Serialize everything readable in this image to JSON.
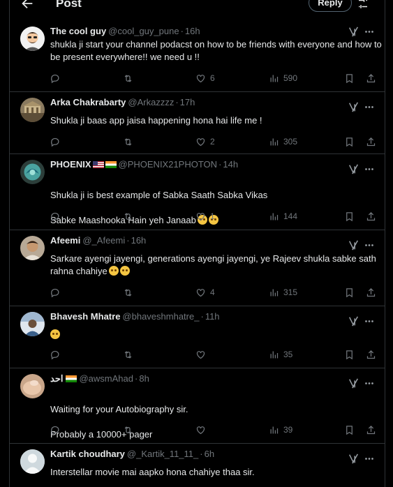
{
  "header": {
    "title": "Post",
    "reply_button": "Reply"
  },
  "tweets": [
    {
      "name": "The cool guy",
      "handle": "@cool_guy_pune",
      "time": "16h",
      "text": "shukla ji start your channel podacst on how to be friends with everyone and how to be present everywhere!! we need u !!",
      "replies": "",
      "retweets": "",
      "likes": "6",
      "views": "590"
    },
    {
      "name": "Arka Chakrabarty",
      "handle": "@Arkazzzz",
      "time": "17h",
      "text": "Shukla ji baas app jaisa happening hona hai life me !",
      "replies": "",
      "retweets": "",
      "likes": "2",
      "views": "305"
    },
    {
      "name": "PHOENIX",
      "handle": "@PHOENIX21PHOTON",
      "time": "14h",
      "text_line1": "Shukla ji is best example of Sabka Saath Sabka Vikas",
      "text_line2": "Sabke Maashooka Hain yeh Janaab",
      "replies": "",
      "retweets": "",
      "likes": "1",
      "views": "144"
    },
    {
      "name": "Afeemi",
      "handle": "@_Afeemi",
      "time": "16h",
      "text": "Sarkare ayengi jayengi, generations ayengi jayengi, ye Rajeev shukla sabke sath rahna chahiye",
      "replies": "",
      "retweets": "",
      "likes": "4",
      "views": "315"
    },
    {
      "name": "Bhavesh Mhatre",
      "handle": "@bhaveshmhatre_",
      "time": "11h",
      "text": "",
      "replies": "",
      "retweets": "",
      "likes": "",
      "views": "35"
    },
    {
      "name": "احد",
      "handle": "@awsmAhad",
      "time": "8h",
      "text_line1": "Waiting for your Autobiography sir.",
      "text_line2": "Probably a 10000+ pager",
      "replies": "",
      "retweets": "",
      "likes": "",
      "views": "39"
    },
    {
      "name": "Kartik choudhary",
      "handle": "@_Kartik_11_11_",
      "time": "6h",
      "text": "Interstellar movie mai aapko hona chahiye thaa sir."
    }
  ],
  "colors": {
    "background": "#000000",
    "text": "#e7e9ea",
    "muted": "#71767b",
    "border": "#2f3336"
  }
}
